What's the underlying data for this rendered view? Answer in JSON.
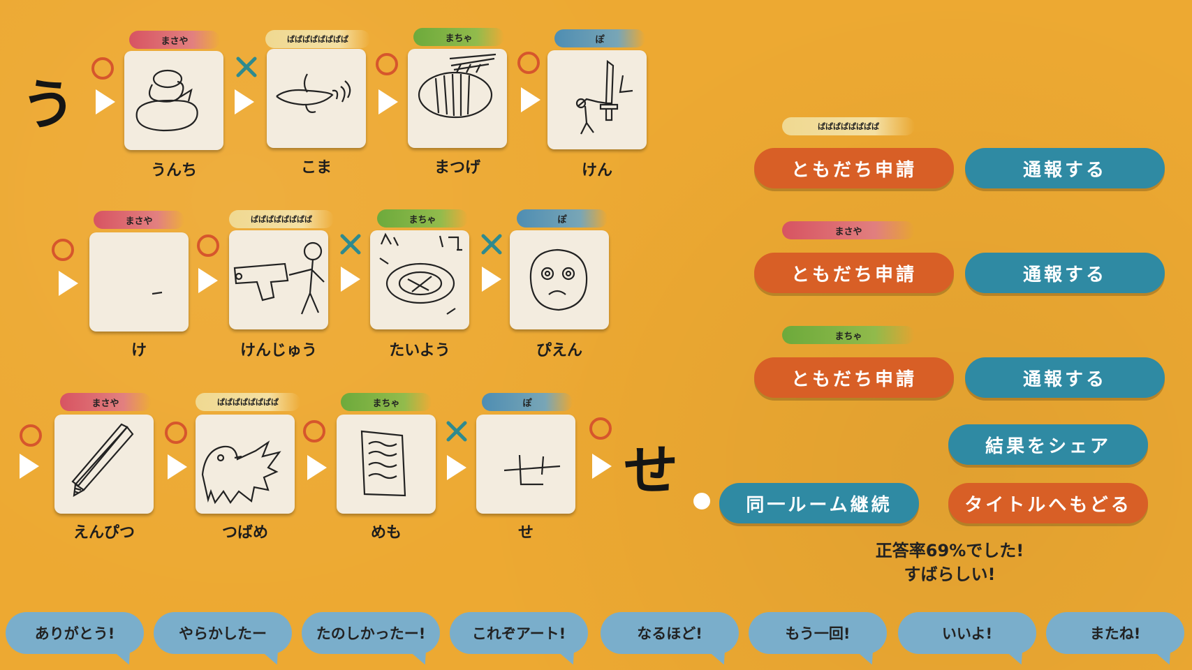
{
  "chain": {
    "start_char": "う",
    "end_char": "せ",
    "rows": [
      {
        "turns": [
          {
            "player": "まさや",
            "color": "red",
            "word": "うんち",
            "icon": "poop-drawing",
            "result": "correct"
          },
          {
            "player": "ぱぱぱぱぱぱぱぱ",
            "color": "gold",
            "word": "こま",
            "icon": "spinning-top-drawing",
            "result": "wrong"
          },
          {
            "player": "まちゃ",
            "color": "green",
            "word": "まつげ",
            "icon": "eyelash-drawing",
            "result": "correct"
          },
          {
            "player": "ぽ",
            "color": "blue",
            "word": "けん",
            "icon": "sword-drawing",
            "result": "correct"
          }
        ]
      },
      {
        "turns": [
          {
            "player": "まさや",
            "color": "red",
            "word": "け",
            "icon": "hair-drawing",
            "result": "correct"
          },
          {
            "player": "ぱぱぱぱぱぱぱぱ",
            "color": "gold",
            "word": "けんじゅう",
            "icon": "gun-drawing",
            "result": "correct"
          },
          {
            "player": "まちゃ",
            "color": "green",
            "word": "たいよう",
            "icon": "sun-drawing",
            "result": "wrong"
          },
          {
            "player": "ぽ",
            "color": "blue",
            "word": "ぴえん",
            "icon": "sad-face-drawing",
            "result": "wrong"
          }
        ]
      },
      {
        "turns": [
          {
            "player": "まさや",
            "color": "red",
            "word": "えんぴつ",
            "icon": "pencil-drawing",
            "result": "correct"
          },
          {
            "player": "ぱぱぱぱぱぱぱぱ",
            "color": "gold",
            "word": "つばめ",
            "icon": "swallow-drawing",
            "result": "correct"
          },
          {
            "player": "まちゃ",
            "color": "green",
            "word": "めも",
            "icon": "memo-drawing",
            "result": "correct"
          },
          {
            "player": "ぽ",
            "color": "blue",
            "word": "せ",
            "icon": "se-drawing",
            "result": "wrong"
          }
        ]
      }
    ],
    "final_result": "correct"
  },
  "players_panel": [
    {
      "name": "ぱぱぱぱぱぱぱぱ",
      "color": "gold",
      "friend_label": "ともだち申請",
      "report_label": "通報する"
    },
    {
      "name": "まさや",
      "color": "red",
      "friend_label": "ともだち申請",
      "report_label": "通報する"
    },
    {
      "name": "まちゃ",
      "color": "green",
      "friend_label": "ともだち申請",
      "report_label": "通報する"
    }
  ],
  "actions": {
    "share_label": "結果をシェア",
    "continue_label": "同一ルーム継続",
    "title_label": "タイトルへもどる"
  },
  "result_text": {
    "line1": "正答率69%でした!",
    "line2": "すばらしい!"
  },
  "chat_stamps": [
    "ありがとう!",
    "やらかしたー",
    "たのしかったー!",
    "これぞアート!",
    "なるほど!",
    "もう一回!",
    "いいよ!",
    "またね!"
  ],
  "colors": {
    "background": "#eda932",
    "orange_button": "#d85f26",
    "teal_button": "#2f8aa3",
    "bubble": "#7aaecb",
    "correct_mark": "#d6562c",
    "wrong_mark": "#2f8a8e"
  }
}
